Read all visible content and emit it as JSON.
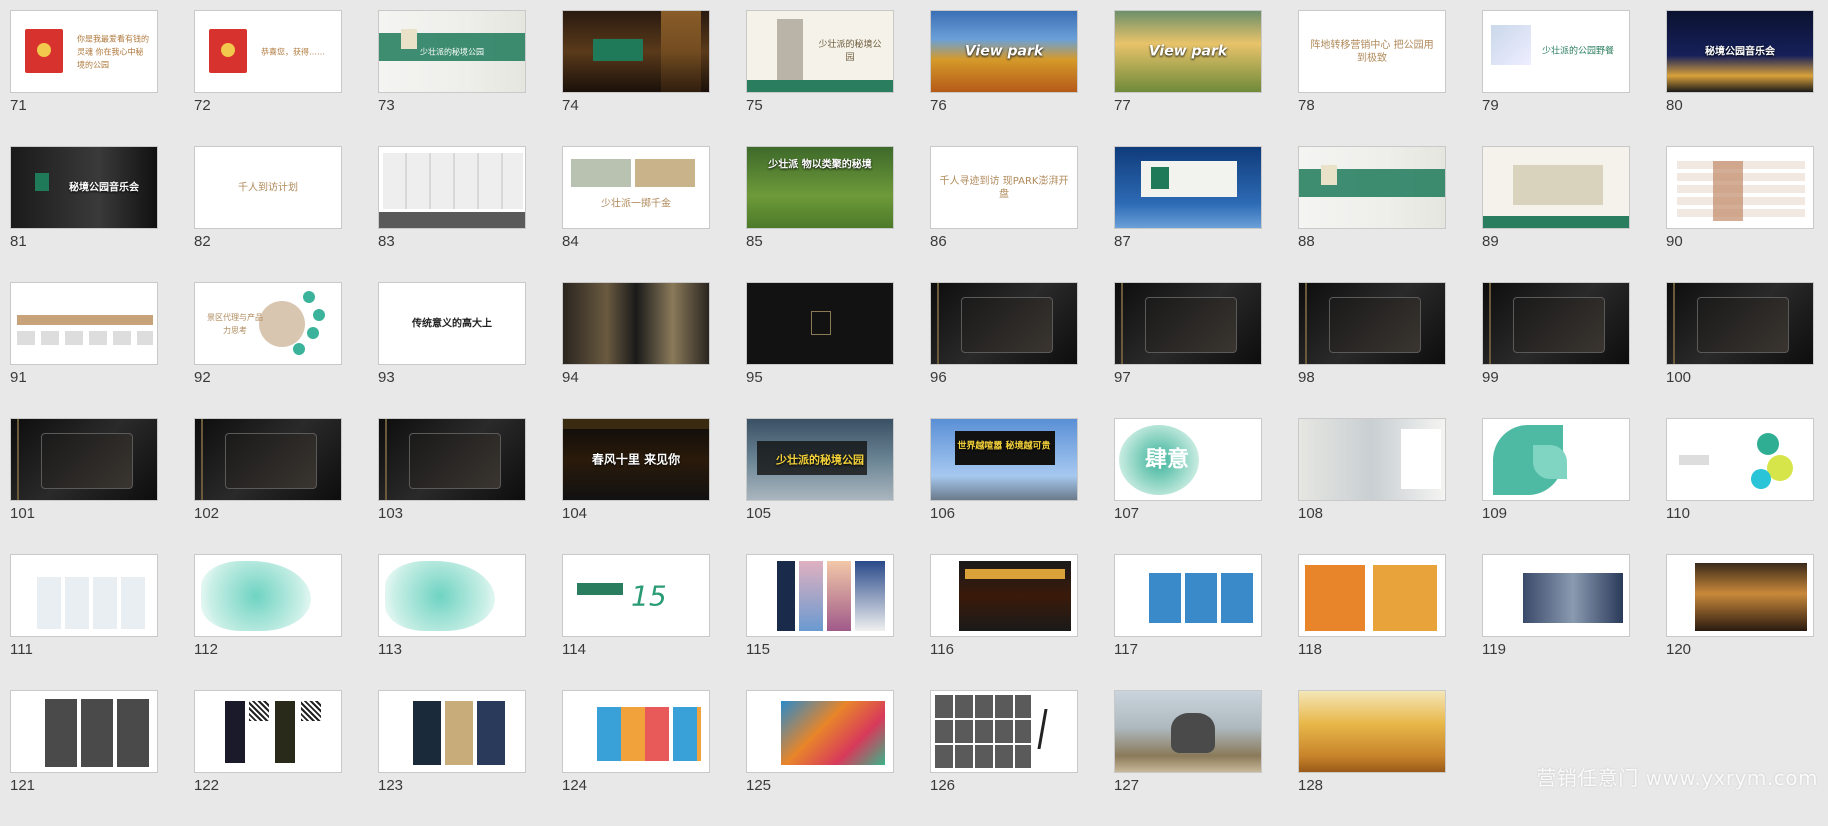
{
  "watermark": "营销任意门 www.yxrym.com",
  "slides": [
    {
      "n": "71",
      "text": "你是我最爱看有钱的灵魂 你在我心中秘境的公园",
      "style": "redpacket"
    },
    {
      "n": "72",
      "text": "恭喜您，获得……",
      "style": "redpacket"
    },
    {
      "n": "73",
      "text": "少壮派的秘境公园",
      "style": "green-banner"
    },
    {
      "n": "74",
      "text": "",
      "style": "night-street"
    },
    {
      "n": "75",
      "text": "少壮派的秘境公园",
      "style": "tower"
    },
    {
      "n": "76",
      "text": "View park",
      "style": "autumn"
    },
    {
      "n": "77",
      "text": "View park",
      "style": "golden-park"
    },
    {
      "n": "78",
      "text": "阵地转移营销中心 把公园用到极致",
      "style": "plain"
    },
    {
      "n": "79",
      "text": "少壮派的公园野餐",
      "style": "picnic"
    },
    {
      "n": "80",
      "text": "秘境公园音乐会",
      "style": "concert"
    },
    {
      "n": "81",
      "text": "秘境公园音乐会",
      "style": "dark-concert"
    },
    {
      "n": "82",
      "text": "千人到访计划",
      "style": "plain"
    },
    {
      "n": "83",
      "text": "",
      "style": "cosmetics"
    },
    {
      "n": "84",
      "text": "少壮派一掷千金",
      "style": "money"
    },
    {
      "n": "85",
      "text": "少壮派 物以类聚的秘境",
      "style": "dogs"
    },
    {
      "n": "86",
      "text": "千人寻迹到访 现PARK澎湃开盘",
      "style": "plain"
    },
    {
      "n": "87",
      "text": "",
      "style": "billboard-sky"
    },
    {
      "n": "88",
      "text": "",
      "style": "green-banner"
    },
    {
      "n": "89",
      "text": "",
      "style": "gate"
    },
    {
      "n": "90",
      "text": "",
      "style": "table"
    },
    {
      "n": "91",
      "text": "",
      "style": "timeline"
    },
    {
      "n": "92",
      "text": "景区代理与产品力思考",
      "style": "bubbles"
    },
    {
      "n": "93",
      "text": "传统意义的高大上",
      "style": "plain-dark"
    },
    {
      "n": "94",
      "text": "",
      "style": "collage"
    },
    {
      "n": "95",
      "text": "",
      "style": "black-logo"
    },
    {
      "n": "96",
      "text": "",
      "style": "black-product"
    },
    {
      "n": "97",
      "text": "",
      "style": "black-product"
    },
    {
      "n": "98",
      "text": "",
      "style": "black-product"
    },
    {
      "n": "99",
      "text": "",
      "style": "black-product"
    },
    {
      "n": "100",
      "text": "",
      "style": "black-product"
    },
    {
      "n": "101",
      "text": "",
      "style": "black-product"
    },
    {
      "n": "102",
      "text": "",
      "style": "black-product"
    },
    {
      "n": "103",
      "text": "",
      "style": "black-product"
    },
    {
      "n": "104",
      "text": "春风十里 来见你",
      "style": "dark-poster"
    },
    {
      "n": "105",
      "text": "少壮派的秘境公园",
      "style": "building-ad"
    },
    {
      "n": "106",
      "text": "世界越喧嚣 秘境越可贵",
      "style": "billboard-city"
    },
    {
      "n": "107",
      "text": "肆意",
      "style": "teal-brush"
    },
    {
      "n": "108",
      "text": "",
      "style": "office"
    },
    {
      "n": "109",
      "text": "",
      "style": "teal-leaves"
    },
    {
      "n": "110",
      "text": "",
      "style": "teal-mindmap"
    },
    {
      "n": "111",
      "text": "",
      "style": "logos"
    },
    {
      "n": "112",
      "text": "",
      "style": "teal-map"
    },
    {
      "n": "113",
      "text": "",
      "style": "teal-map"
    },
    {
      "n": "114",
      "text": "15",
      "style": "anniv"
    },
    {
      "n": "115",
      "text": "",
      "style": "posters"
    },
    {
      "n": "116",
      "text": "",
      "style": "black-ads"
    },
    {
      "n": "117",
      "text": "",
      "style": "panels"
    },
    {
      "n": "118",
      "text": "",
      "style": "orange-ads"
    },
    {
      "n": "119",
      "text": "",
      "style": "people"
    },
    {
      "n": "120",
      "text": "",
      "style": "event"
    },
    {
      "n": "121",
      "text": "",
      "style": "event-photos"
    },
    {
      "n": "122",
      "text": "",
      "style": "qr-posters"
    },
    {
      "n": "123",
      "text": "",
      "style": "posters-2"
    },
    {
      "n": "124",
      "text": "",
      "style": "colorful-banners"
    },
    {
      "n": "125",
      "text": "",
      "style": "festival"
    },
    {
      "n": "126",
      "text": "",
      "style": "portraits"
    },
    {
      "n": "127",
      "text": "",
      "style": "elephant"
    },
    {
      "n": "128",
      "text": "",
      "style": "wheat"
    }
  ]
}
